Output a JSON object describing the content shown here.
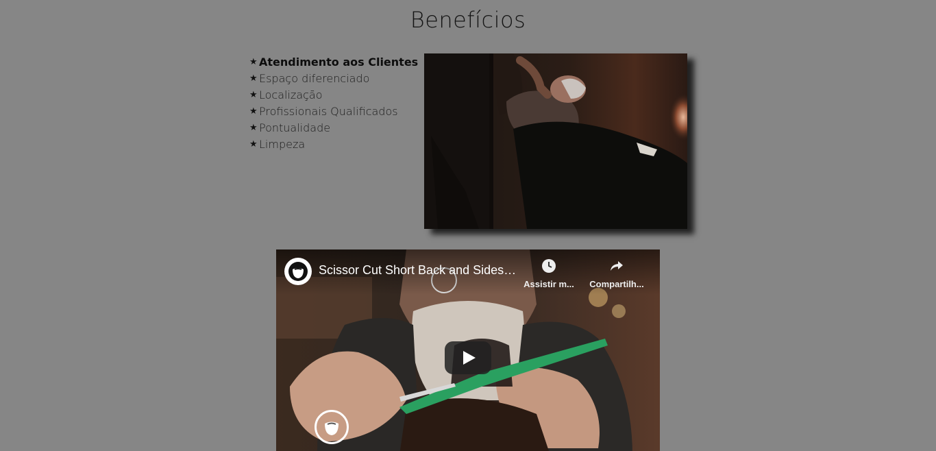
{
  "section": {
    "title": "Benefícios"
  },
  "benefits": [
    {
      "label": "Atendimento aos Clientes",
      "icon": "star-icon"
    },
    {
      "label": "Espaço diferenciado",
      "icon": "star-icon"
    },
    {
      "label": "Localização",
      "icon": "star-icon"
    },
    {
      "label": "Profissionais Qualificados",
      "icon": "star-icon"
    },
    {
      "label": "Pontualidade",
      "icon": "star-icon"
    },
    {
      "label": "Limpeza",
      "icon": "star-icon"
    }
  ],
  "photo": {
    "subject": "barber-shaving-client-photo"
  },
  "video": {
    "title": "Scissor Cut Short Back and Sides ...",
    "watch_later_label": "Assistir m...",
    "share_label": "Compartilh...",
    "channel_icon": "beard-logo-icon",
    "play_icon": "play-icon"
  },
  "colors": {
    "background": "#868686",
    "text": "#141414"
  }
}
